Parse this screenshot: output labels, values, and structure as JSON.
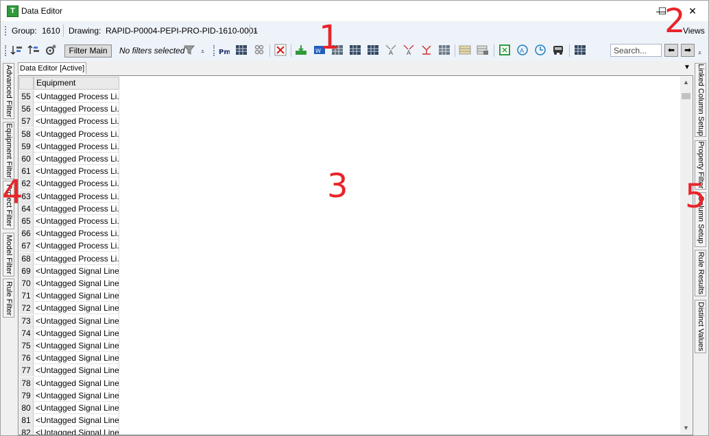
{
  "window": {
    "title": "Data Editor",
    "app_icon_letter": "T"
  },
  "controls": {
    "minimize": "—",
    "maximize": "☐",
    "close": "✕"
  },
  "infobar": {
    "group_label": "Group:",
    "group_value": "1610",
    "drawing_label": "Drawing:",
    "drawing_value": "RAPID-P0004-PEPI-PRO-PID-1610-0001",
    "views_label": "Views"
  },
  "toolbar": {
    "filter_main_label": "Filter Main",
    "no_filters_text": "No filters selected",
    "search_placeholder": "Search...",
    "nav_back": "⬅",
    "nav_forward": "➡"
  },
  "tabs": {
    "active_tab": "Data Editor [Active]"
  },
  "left_panels": [
    "Advanced Filter",
    "Equipment Filter",
    "Project Filter",
    "Model Filter",
    "Rule Filter"
  ],
  "right_panels": [
    "Linked Column Setup",
    "Property Filter",
    "Column Setup",
    "Rule Results",
    "Distinct Values"
  ],
  "grid": {
    "column_header": "Equipment",
    "rows": [
      {
        "num": "55",
        "value": "<Untagged Process Li..."
      },
      {
        "num": "56",
        "value": "<Untagged Process Li..."
      },
      {
        "num": "57",
        "value": "<Untagged Process Li..."
      },
      {
        "num": "58",
        "value": "<Untagged Process Li..."
      },
      {
        "num": "59",
        "value": "<Untagged Process Li..."
      },
      {
        "num": "60",
        "value": "<Untagged Process Li..."
      },
      {
        "num": "61",
        "value": "<Untagged Process Li..."
      },
      {
        "num": "62",
        "value": "<Untagged Process Li..."
      },
      {
        "num": "63",
        "value": "<Untagged Process Li..."
      },
      {
        "num": "64",
        "value": "<Untagged Process Li..."
      },
      {
        "num": "65",
        "value": "<Untagged Process Li..."
      },
      {
        "num": "66",
        "value": "<Untagged Process Li..."
      },
      {
        "num": "67",
        "value": "<Untagged Process Li..."
      },
      {
        "num": "68",
        "value": "<Untagged Process Li..."
      },
      {
        "num": "69",
        "value": "<Untagged Signal Line>"
      },
      {
        "num": "70",
        "value": "<Untagged Signal Line>"
      },
      {
        "num": "71",
        "value": "<Untagged Signal Line>"
      },
      {
        "num": "72",
        "value": "<Untagged Signal Line>"
      },
      {
        "num": "73",
        "value": "<Untagged Signal Line>"
      },
      {
        "num": "74",
        "value": "<Untagged Signal Line..."
      },
      {
        "num": "75",
        "value": "<Untagged Signal Line..."
      },
      {
        "num": "76",
        "value": "<Untagged Signal Line..."
      },
      {
        "num": "77",
        "value": "<Untagged Signal Line..."
      },
      {
        "num": "78",
        "value": "<Untagged Signal Line..."
      },
      {
        "num": "79",
        "value": "<Untagged Signal Line..."
      },
      {
        "num": "80",
        "value": "<Untagged Signal Line..."
      },
      {
        "num": "81",
        "value": "<Untagged Signal Line..."
      },
      {
        "num": "82",
        "value": "<Untagged Signal Line..."
      }
    ]
  },
  "annotations": {
    "one": "1",
    "two": "2",
    "three": "3",
    "four": "4",
    "five": "5"
  },
  "colors": {
    "annotation": "#e8242a",
    "toolbar_bg": "#eef3fa"
  }
}
